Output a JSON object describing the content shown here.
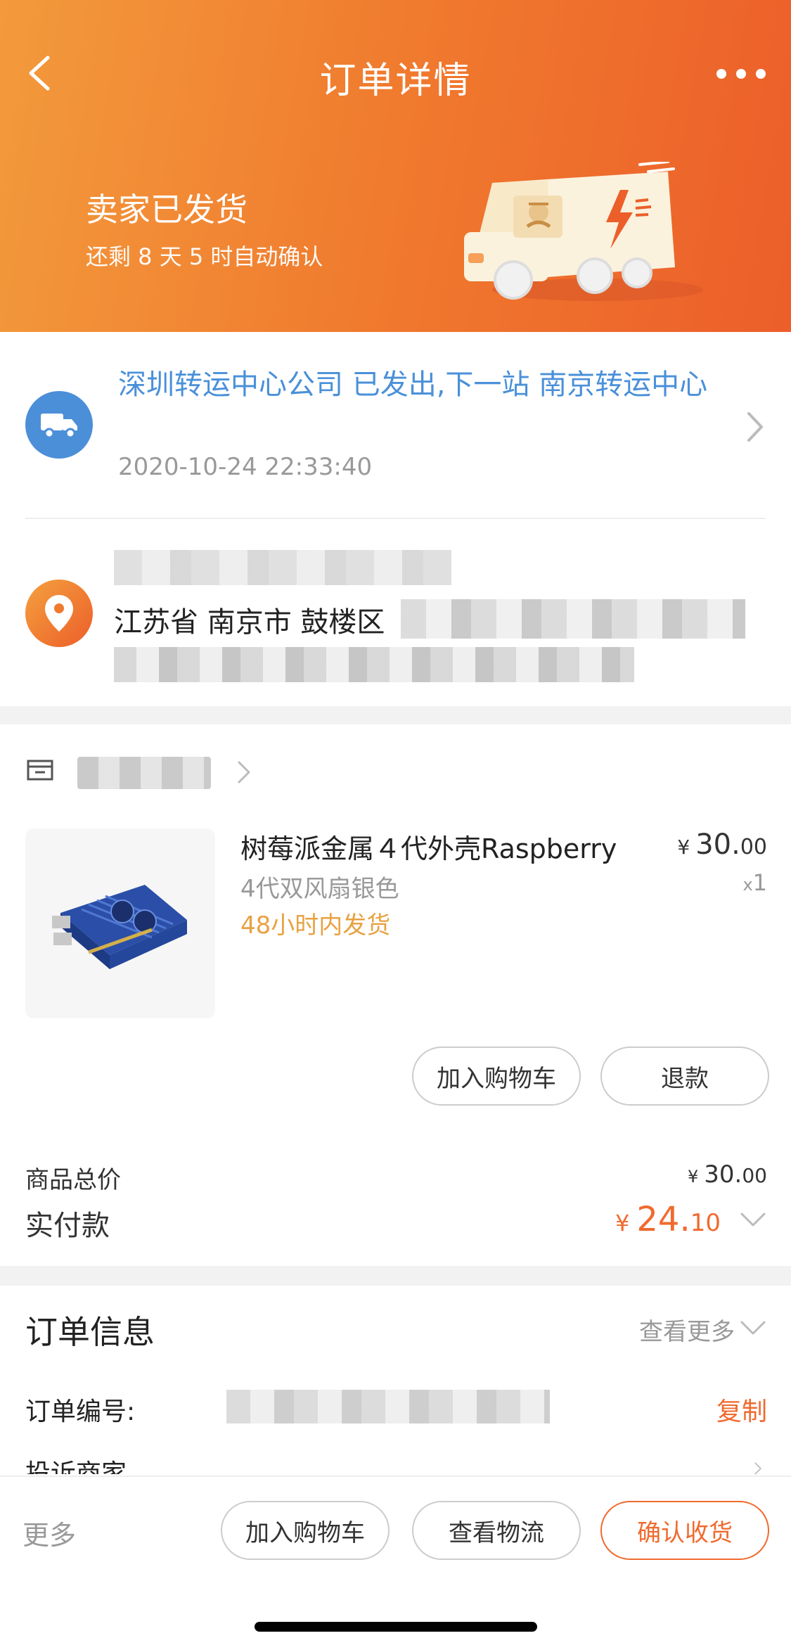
{
  "header": {
    "title": "订单详情",
    "status_title": "卖家已发货",
    "status_sub": "还剩 8 天 5 时自动确认"
  },
  "logistics": {
    "message": "深圳转运中心公司 已发出,下一站 南京转运中心",
    "time": "2020-10-24 22:33:40"
  },
  "address": {
    "line": "江苏省 南京市 鼓楼区"
  },
  "product": {
    "name": "树莓派金属４代外壳Raspberry",
    "sku": "4代双风扇银色",
    "shipping": "48小时内发货",
    "price_currency": "¥",
    "price_int": "30.",
    "price_dec": "00",
    "qty_prefix": "x",
    "qty": "1",
    "btn_cart": "加入购物车",
    "btn_refund": "退款"
  },
  "summary": {
    "total_label": "商品总价",
    "total_currency": "¥",
    "total_int": "30.",
    "total_dec": "00",
    "paid_label": "实付款",
    "paid_currency": "¥",
    "paid_int": "24.",
    "paid_dec": "10"
  },
  "order_info": {
    "title": "订单信息",
    "more": "查看更多",
    "order_no_label": "订单编号:",
    "copy": "复制",
    "complain": "投诉商家"
  },
  "bottom_bar": {
    "more": "更多",
    "cart": "加入购物车",
    "logistics": "查看物流",
    "confirm": "确认收货"
  },
  "colors": {
    "accent": "#f06a2e",
    "link_blue": "#4a90d9",
    "ship_orange": "#e8a242"
  }
}
